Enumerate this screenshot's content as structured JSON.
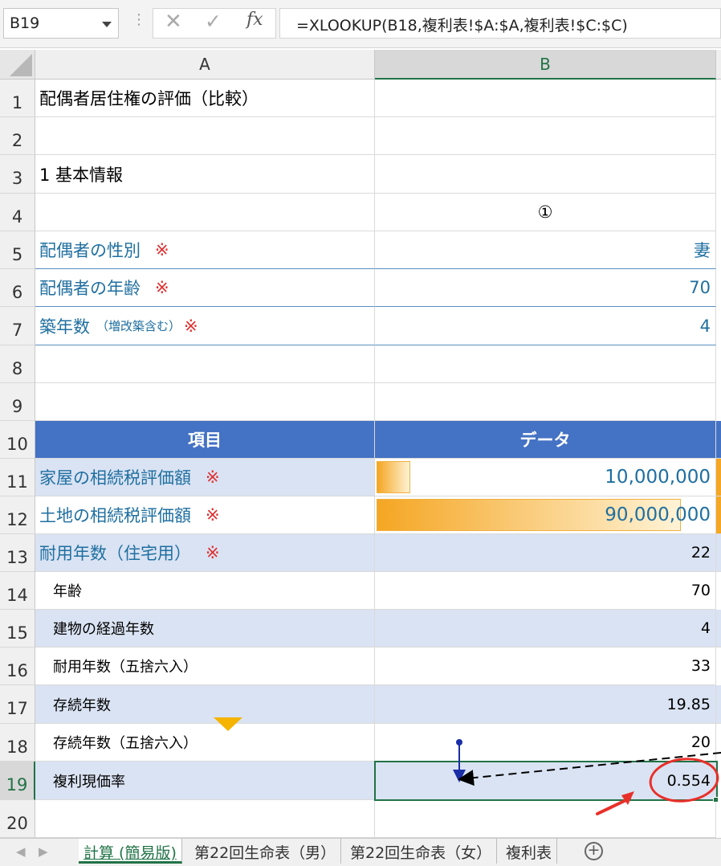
{
  "formula_bar": {
    "name_box": "B19",
    "cancel_icon": "✕",
    "enter_icon": "✓",
    "fx_label": "fx",
    "formula": "=XLOOKUP(B18,複利表!$A:$A,複利表!$C:$C)"
  },
  "columns": [
    "A",
    "B"
  ],
  "rows": [
    {
      "n": "1",
      "a": "配偶者居住権の評価（比較）",
      "b": ""
    },
    {
      "n": "2",
      "a": "",
      "b": ""
    },
    {
      "n": "3",
      "a": "1 基本情報",
      "b": ""
    },
    {
      "n": "4",
      "a": "",
      "b": "①"
    },
    {
      "n": "5",
      "a": "配偶者の性別",
      "a_mark": "※",
      "b": "妻"
    },
    {
      "n": "6",
      "a": "配偶者の年齢",
      "a_mark": "※",
      "b": "70"
    },
    {
      "n": "7",
      "a": "築年数",
      "a_sub": "（増改築含む）",
      "a_mark": "※",
      "b": "4"
    },
    {
      "n": "8",
      "a": "",
      "b": ""
    },
    {
      "n": "9",
      "a": "",
      "b": ""
    },
    {
      "n": "10",
      "a": "項目",
      "b": "データ"
    },
    {
      "n": "11",
      "a": "家屋の相続税評価額",
      "a_mark": "※",
      "b": "10,000,000",
      "bar_fraction": 0.1
    },
    {
      "n": "12",
      "a": "土地の相続税評価額",
      "a_mark": "※",
      "b": "90,000,000",
      "bar_fraction": 0.9
    },
    {
      "n": "13",
      "a": "耐用年数（住宅用）",
      "a_mark": "※",
      "b": "22"
    },
    {
      "n": "14",
      "a": "年齢",
      "b": "70"
    },
    {
      "n": "15",
      "a": "建物の経過年数",
      "b": "4"
    },
    {
      "n": "16",
      "a": "耐用年数（五捨六入）",
      "b": "33"
    },
    {
      "n": "17",
      "a": "存続年数",
      "b": "19.85"
    },
    {
      "n": "18",
      "a": "存続年数（五捨六入）",
      "b": "20"
    },
    {
      "n": "19",
      "a": "複利現価率",
      "b": "0.554"
    },
    {
      "n": "20",
      "a": "",
      "b": ""
    }
  ],
  "sheet_tabs": [
    "計算 (簡易版)",
    "第22回生命表（男）",
    "第22回生命表（女）",
    "複利表"
  ],
  "colors": {
    "header_blue": "#4472c4",
    "band_blue": "#dae3f3",
    "teal_text": "#1f6fa0",
    "excel_green": "#217346",
    "annotation_red": "#e03030"
  }
}
